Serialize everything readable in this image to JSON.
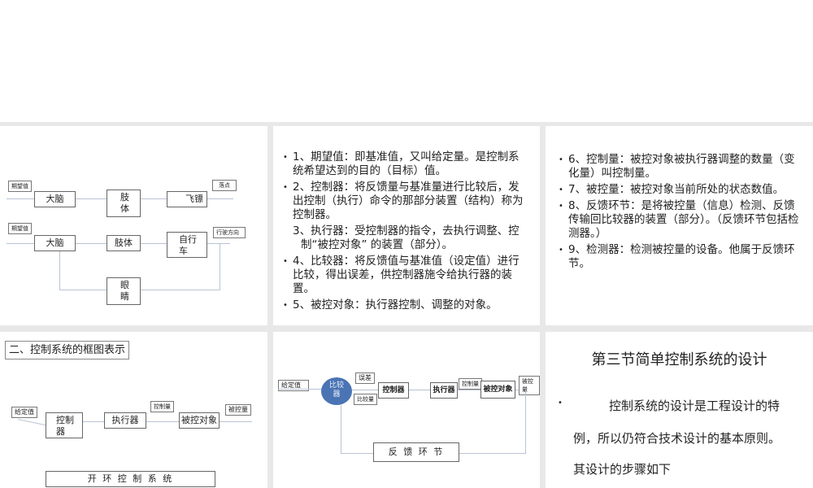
{
  "slide1": {
    "d1": {
      "input": "期望值",
      "b1": "大脑",
      "b2": "肢体",
      "b3": "飞镖",
      "output": "落点"
    },
    "d2": {
      "input": "期望值",
      "b1": "大脑",
      "b2": "肢体",
      "b3": "自行车",
      "output": "行驶方向",
      "feedback": "眼睛"
    }
  },
  "slide2": {
    "items": [
      "1、期望值：即基准值，又叫给定量。是控制系统希望达到的目的（目标）值。",
      "2、控制器：将反馈量与基准量进行比较后，发出控制（执行）命令的那部分装置（结构）称为控制器。",
      "3、执行器：受控制器的指令，去执行调整、控制“被控对象” 的装置（部分）。",
      "4、比较器：将反馈值与基准值（设定值）进行比较，得出误差，供控制器施令给执行器的装置。",
      "5、被控对象：执行器控制、调整的对象。"
    ]
  },
  "slide3": {
    "items": [
      "6、控制量：被控对象被执行器调整的数量（变化量）叫控制量。",
      "7、被控量：被控对象当前所处的状态数值。",
      "8、反馈环节：是将被控量（信息）检测、反馈传输回比较器的装置（部分）。（反馈环节包括检测器。）",
      "9、检测器：检测被控量的设备。他属于反馈环节。"
    ]
  },
  "slide4": {
    "title": "二、控制系统的框图表示",
    "input": "给定值",
    "b1": "控制器",
    "b2": "执行器",
    "mid": "控制量",
    "b3": "被控对象",
    "output": "被控量",
    "caption": "开 环 控 制 系 统"
  },
  "slide5": {
    "input": "给定值",
    "comparator": "比较器",
    "error": "误差",
    "compare": "比较量",
    "b1": "控制器",
    "b2": "执行器",
    "mid": "控制量",
    "b3": "被控对象",
    "output": "被控量",
    "feedback": "反 馈 环 节"
  },
  "slide6": {
    "title": "第三节简单控制系统的设计",
    "lines": [
      "控制系统的设计是工程设计的特",
      "例，所以仍符合技术设计的基本原则。",
      "其设计的步骤如下"
    ]
  }
}
